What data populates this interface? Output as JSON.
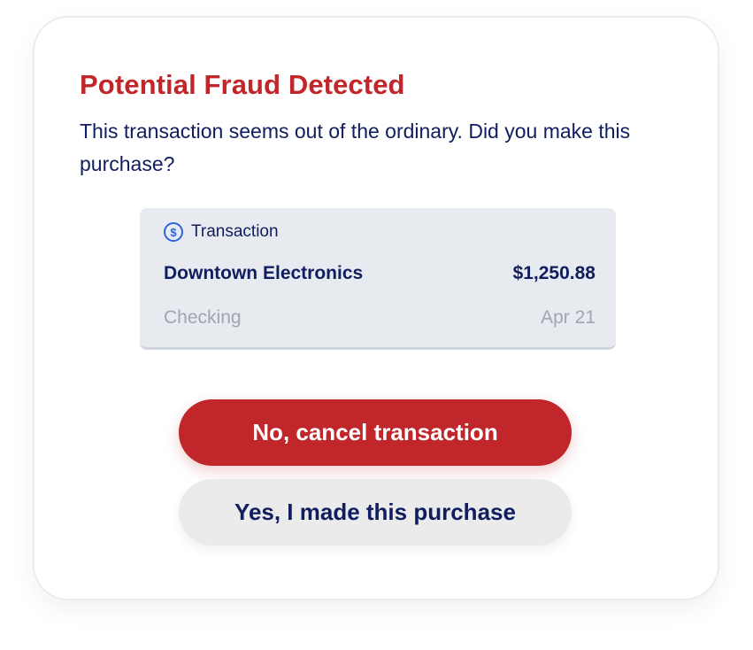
{
  "dialog": {
    "title": "Potential Fraud Detected",
    "message": "This transaction seems out of the ordinary. Did you make this purchase?"
  },
  "transaction": {
    "icon": "dollar-circle-icon",
    "label": "Transaction",
    "merchant": "Downtown Electronics",
    "amount": "$1,250.88",
    "account": "Checking",
    "date": "Apr 21"
  },
  "actions": {
    "cancel_label": "No, cancel transaction",
    "confirm_label": "Yes, I made this purchase"
  },
  "colors": {
    "title": "#c0262a",
    "primary_button": "#c0262a",
    "secondary_button": "#ebebeb",
    "text": "#101d5e",
    "icon": "#2d63e0",
    "muted": "#9ea5b3"
  }
}
